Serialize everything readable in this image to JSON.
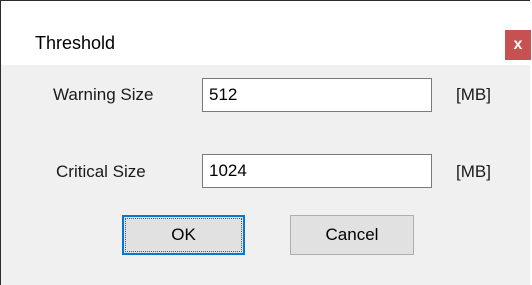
{
  "window": {
    "title": "Threshold",
    "close_glyph": "x",
    "close_color": "#c75050"
  },
  "fields": [
    {
      "label": "Warning Size",
      "value": "512",
      "unit": "[MB]"
    },
    {
      "label": "Critical Size",
      "value": "1024",
      "unit": "[MB]"
    }
  ],
  "buttons": {
    "ok_label": "OK",
    "cancel_label": "Cancel",
    "focus_color": "#0078d7"
  }
}
